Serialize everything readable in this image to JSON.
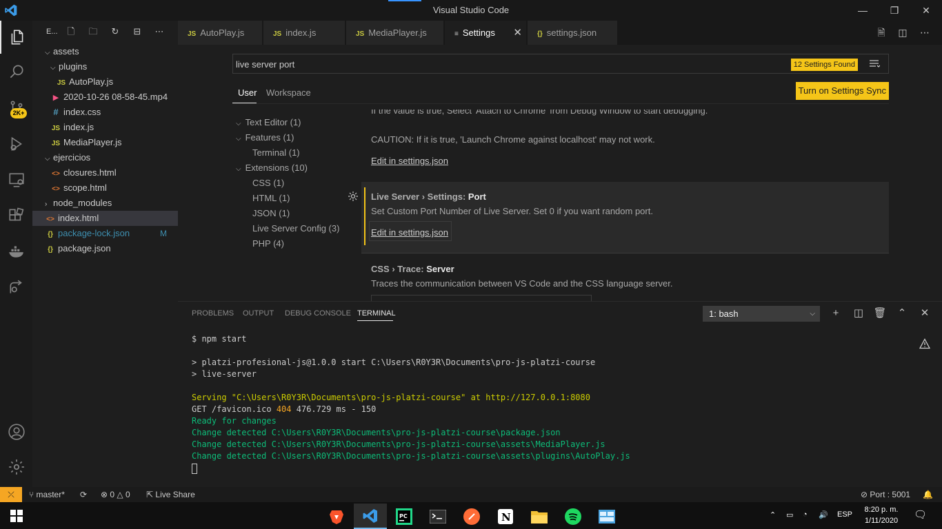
{
  "window": {
    "title": "Visual Studio Code",
    "minimize": "—",
    "restore": "❐",
    "close": "✕"
  },
  "activity": {
    "badge": "2K+"
  },
  "explorer": {
    "header": "E...",
    "items": [
      {
        "label": "assets",
        "type": "folder-open",
        "indent": 1
      },
      {
        "label": "plugins",
        "type": "folder-open",
        "indent": 2
      },
      {
        "label": "AutoPlay.js",
        "type": "js",
        "indent": 3
      },
      {
        "label": "2020-10-26 08-58-45.mp4",
        "type": "mp4",
        "indent": 2
      },
      {
        "label": "index.css",
        "type": "css",
        "indent": 2
      },
      {
        "label": "index.js",
        "type": "js",
        "indent": 2
      },
      {
        "label": "MediaPlayer.js",
        "type": "js",
        "indent": 2
      },
      {
        "label": "ejercicios",
        "type": "folder-open",
        "indent": 1
      },
      {
        "label": "closures.html",
        "type": "html",
        "indent": 2
      },
      {
        "label": "scope.html",
        "type": "html",
        "indent": 2
      },
      {
        "label": "node_modules",
        "type": "folder-closed",
        "indent": 1
      },
      {
        "label": "index.html",
        "type": "html",
        "indent": 1
      },
      {
        "label": "package-lock.json",
        "type": "json",
        "indent": 1,
        "git": "M"
      },
      {
        "label": "package.json",
        "type": "json",
        "indent": 1
      }
    ]
  },
  "tabs": [
    {
      "label": "AutoPlay.js",
      "icon": "JS"
    },
    {
      "label": "index.js",
      "icon": "JS"
    },
    {
      "label": "MediaPlayer.js",
      "icon": "JS"
    },
    {
      "label": "Settings",
      "icon": "≡",
      "close": "✕"
    },
    {
      "label": "settings.json",
      "icon": "{}"
    }
  ],
  "settings": {
    "search_value": "live server port",
    "found": "12 Settings Found",
    "scope_user": "User",
    "scope_workspace": "Workspace",
    "sync_button": "Turn on Settings Sync",
    "toc": [
      "Text Editor (1)",
      "Features (1)",
      "Terminal (1)",
      "Extensions (10)",
      "CSS (1)",
      "HTML (1)",
      "JSON (1)",
      "Live Server Config (3)",
      "PHP (4)"
    ],
    "prev_desc_1": "If the value is true, Select 'Attach to Chrome' from Debug Window to start debugging.",
    "prev_desc_2": "CAUTION: If it is true, 'Launch Chrome against localhost' may not work.",
    "edit_link": "Edit in settings.json",
    "port_title_prefix": "Live Server › Settings: ",
    "port_title_name": "Port",
    "port_desc": "Set Custom Port Number of Live Server. Set 0 if you want random port.",
    "css_title_prefix": "CSS › Trace: ",
    "css_title_name": "Server",
    "css_desc": "Traces the communication between VS Code and the CSS language server."
  },
  "panel": {
    "tabs": [
      "PROBLEMS",
      "OUTPUT",
      "DEBUG CONSOLE",
      "TERMINAL"
    ],
    "terminal_select": "1: bash",
    "lines": {
      "l1": "$ npm start",
      "l2": "> platzi-profesional-js@1.0.0 start C:\\Users\\R0Y3R\\Documents\\pro-js-platzi-course",
      "l3": "> live-server",
      "l4": "Serving \"C:\\Users\\R0Y3R\\Documents\\pro-js-platzi-course\" at http://127.0.0.1:8080",
      "l5a": "GET /favicon.ico ",
      "l5b": "404",
      "l5c": " 476.729 ms - 150",
      "l6": "Ready for changes",
      "l7": "Change detected C:\\Users\\R0Y3R\\Documents\\pro-js-platzi-course\\package.json",
      "l8": "Change detected C:\\Users\\R0Y3R\\Documents\\pro-js-platzi-course\\assets\\MediaPlayer.js",
      "l9": "Change detected C:\\Users\\R0Y3R\\Documents\\pro-js-platzi-course\\assets\\plugins\\AutoPlay.js"
    }
  },
  "status": {
    "branch": "master*",
    "errors": "0",
    "warnings": "0",
    "live_share": "Live Share",
    "port": "Port : 5001"
  },
  "taskbar": {
    "lang": "ESP",
    "time": "8:20 p. m.",
    "date": "1/11/2020"
  }
}
